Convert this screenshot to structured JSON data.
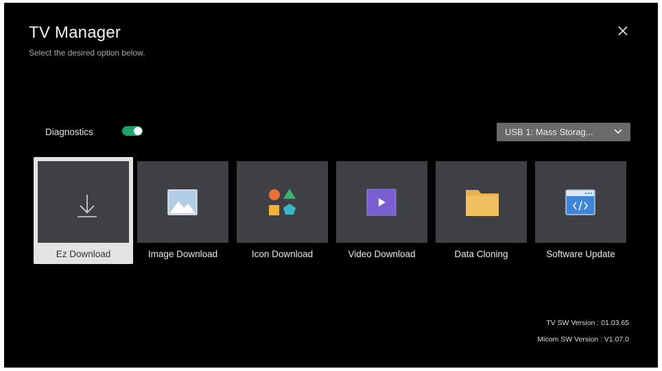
{
  "header": {
    "title": "TV Manager",
    "subtitle": "Select the desired option below."
  },
  "diagnostics": {
    "label": "Diagnostics",
    "enabled": true
  },
  "usb_select": {
    "value": "USB 1: Mass Storag..."
  },
  "tiles": [
    {
      "label": "Ez Download",
      "icon": "download-icon",
      "focused": true
    },
    {
      "label": "Image Download",
      "icon": "image-icon",
      "focused": false
    },
    {
      "label": "Icon Download",
      "icon": "shapes-icon",
      "focused": false
    },
    {
      "label": "Video Download",
      "icon": "video-icon",
      "focused": false
    },
    {
      "label": "Data Cloning",
      "icon": "folder-icon",
      "focused": false
    },
    {
      "label": "Software Update",
      "icon": "code-window-icon",
      "focused": false
    }
  ],
  "versions": {
    "tv_sw": "TV SW Version : 01.03.65",
    "micom_sw": "Micom SW Version : V1.07.0"
  },
  "colors": {
    "background": "#000000",
    "tile": "#3e4045",
    "focus": "#e3e3e3",
    "toggle_on": "#1ea16a",
    "image_icon": "#b4cde6",
    "video_icon": "#7a5fd0",
    "folder_icon": "#f0c060",
    "code_icon": "#3f86d8"
  }
}
